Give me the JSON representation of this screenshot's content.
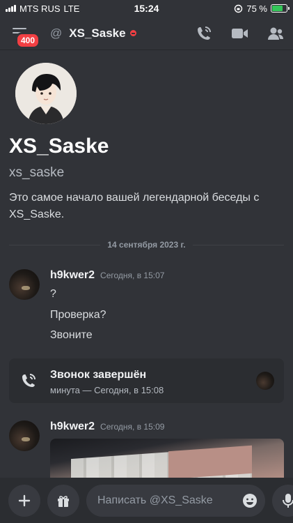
{
  "status_bar": {
    "carrier": "MTS RUS",
    "network": "LTE",
    "time": "15:24",
    "battery_percent": "75 %",
    "battery_level": 0.75
  },
  "header": {
    "notification_count": "400",
    "channel_prefix": "@",
    "title": "XS_Saske",
    "icons": [
      "menu-icon",
      "phone-call-icon",
      "video-camera-icon",
      "members-icon"
    ]
  },
  "profile": {
    "display_name": "XS_Saske",
    "username": "xs_saske",
    "description": "Это самое начало вашей легендарной беседы с XS_Saske."
  },
  "date_divider": "14 сентября 2023 г.",
  "messages": [
    {
      "author": "h9kwer2",
      "timestamp": "Сегодня, в 15:07",
      "lines": [
        "?",
        "Проверка?",
        "Звоните"
      ]
    },
    {
      "author": "h9kwer2",
      "timestamp": "Сегодня, в 15:09"
    }
  ],
  "call": {
    "title": "Звонок завершён",
    "subtitle": "минута — Сегодня, в 15:08"
  },
  "composer": {
    "placeholder": "Написать @XS_Saske"
  },
  "colors": {
    "background": "#313338",
    "composer_background": "#2b2d31",
    "badge": "#f23f43",
    "battery": "#34c759"
  }
}
